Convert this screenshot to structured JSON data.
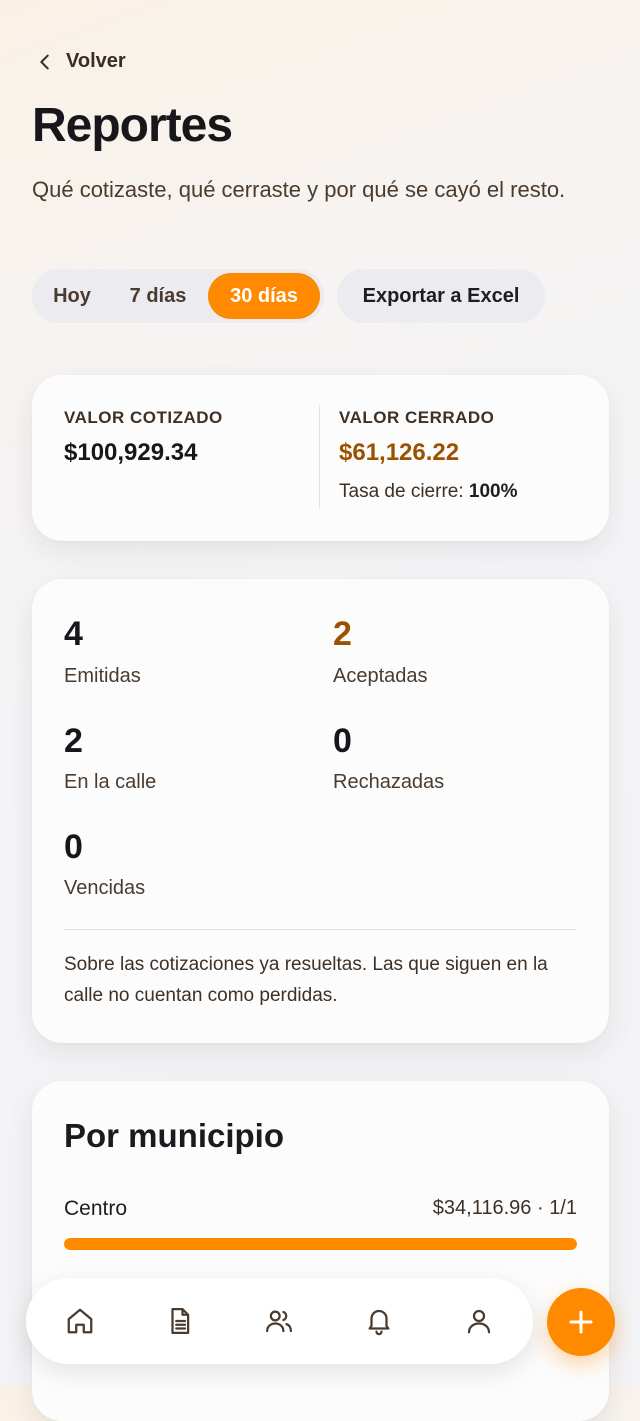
{
  "header": {
    "back_label": "Volver",
    "title": "Reportes",
    "subtitle": "Qué cotizaste, qué cerraste y por qué se cayó el resto."
  },
  "filters": {
    "periods": [
      "Hoy",
      "7 días",
      "30 días"
    ],
    "selected": "30 días",
    "export_label": "Exportar a Excel"
  },
  "summary": {
    "quoted_label": "VALOR COTIZADO",
    "quoted_value": "$100,929.34",
    "closed_label": "VALOR CERRADO",
    "closed_value": "$61,126.22",
    "close_rate_label": "Tasa de cierre:",
    "close_rate_value": "100%"
  },
  "stats": {
    "items": [
      {
        "value": "4",
        "label": "Emitidas"
      },
      {
        "value": "2",
        "label": "Aceptadas"
      },
      {
        "value": "2",
        "label": "En la calle"
      },
      {
        "value": "0",
        "label": "Rechazadas"
      },
      {
        "value": "0",
        "label": "Vencidas"
      }
    ],
    "note": "Sobre las cotizaciones ya resueltas. Las que siguen en la calle no cuentan como perdidas."
  },
  "municipios": {
    "title": "Por municipio",
    "rows": [
      {
        "name": "Centro",
        "amount": "$34,116.96",
        "ratio": "1/1",
        "separator": "·",
        "fill_fraction": 1.0
      }
    ]
  },
  "nav": {
    "items": [
      "home-icon",
      "document-icon",
      "users-icon",
      "bell-icon",
      "profile-icon"
    ]
  },
  "colors": {
    "accent": "#ff8a00",
    "closed_amount": "#9a5200"
  }
}
